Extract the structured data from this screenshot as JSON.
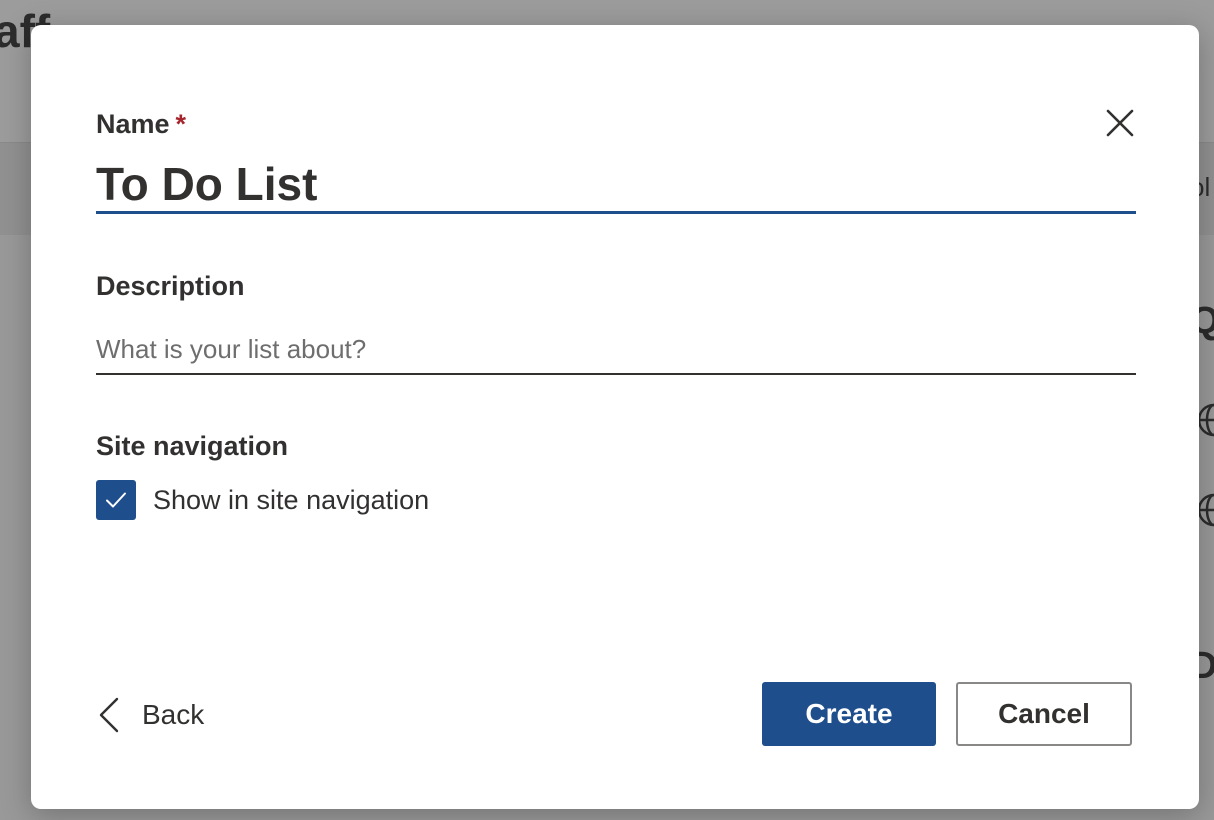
{
  "background": {
    "title_fragment": "aff",
    "right_fragments": [
      "ol",
      "Q",
      "D"
    ],
    "icons": [
      "globe-icon",
      "globe-icon"
    ]
  },
  "dialog": {
    "name_label": "Name",
    "required_marker": "*",
    "name_value": "To Do List",
    "description_label": "Description",
    "description_placeholder": "What is your list about?",
    "description_value": "",
    "site_navigation_label": "Site navigation",
    "show_in_nav_label": "Show in site navigation",
    "show_in_nav_checked": true,
    "back_label": "Back",
    "create_label": "Create",
    "cancel_label": "Cancel",
    "close_icon": "close-icon"
  },
  "colors": {
    "accent": "#1f4e8c",
    "required": "#a4262c",
    "text": "#323130"
  }
}
